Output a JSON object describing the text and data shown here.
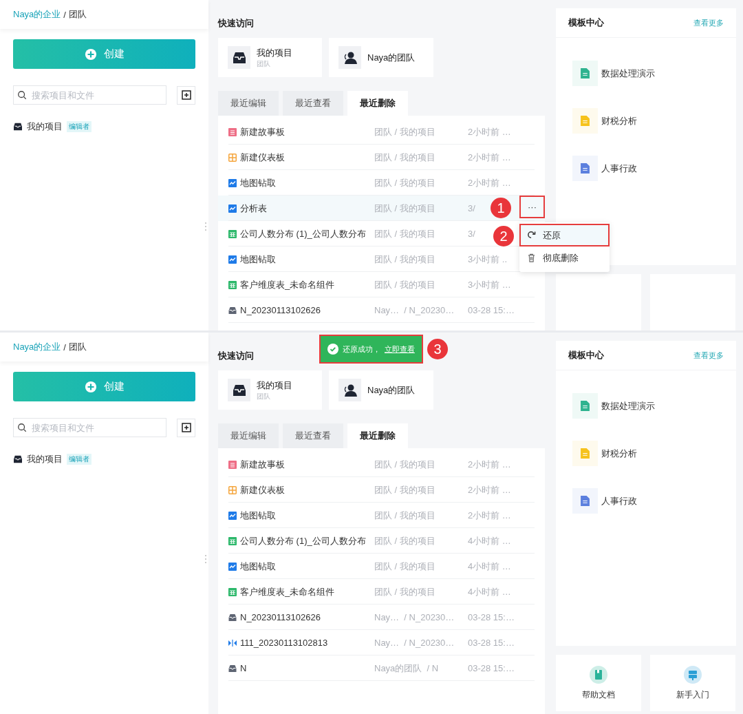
{
  "panels": [
    {
      "breadcrumb": {
        "link": "Naya的企业",
        "separator": "/",
        "current": "团队"
      },
      "create_button": "创建",
      "search": {
        "placeholder": "搜索项目和文件"
      },
      "sidebar_items": [
        {
          "label": "我的项目",
          "badge": "编辑者"
        }
      ],
      "quick_access": {
        "title": "快速访问",
        "items": [
          {
            "kind": "project",
            "title": "我的项目",
            "subtitle": "团队"
          },
          {
            "kind": "team",
            "title": "Naya的团队"
          }
        ]
      },
      "tabs": [
        {
          "label": "最近编辑",
          "selected": false
        },
        {
          "label": "最近查看",
          "selected": false
        },
        {
          "label": "最近删除",
          "selected": true
        }
      ],
      "files": [
        {
          "kind": "story",
          "name": "新建故事板",
          "path": "团队 / 我的项目",
          "time": "2小时前 …",
          "selected": false
        },
        {
          "kind": "dashboard",
          "name": "新建仪表板",
          "path": "团队 / 我的项目",
          "time": "2小时前 …",
          "selected": false
        },
        {
          "kind": "map",
          "name": "地图钻取",
          "path": "团队 / 我的项目",
          "time": "2小时前 …",
          "selected": false
        },
        {
          "kind": "map",
          "name": "分析表",
          "path": "团队 / 我的项目",
          "time": "3/",
          "selected": true,
          "menu_open": true
        },
        {
          "kind": "table",
          "name": "公司人数分布 (1)_公司人数分布",
          "path": "团队 / 我的项目",
          "time": "3/",
          "selected": false
        },
        {
          "kind": "map",
          "name": "地图钻取",
          "path": "团队 / 我的项目",
          "time": "3小时前 ..",
          "selected": false
        },
        {
          "kind": "table",
          "name": "客户维度表_未命名组件",
          "path": "团队 / 我的项目",
          "time": "3小时前 …",
          "selected": false
        },
        {
          "kind": "project",
          "name": "N_20230113102626",
          "path": "Nay…  / N_20230…",
          "time": "03-28 15:…",
          "selected": false
        }
      ],
      "row_menu": {
        "more": "···",
        "marker": "1",
        "items": [
          {
            "kind": "restore",
            "label": "还原",
            "marker": "2",
            "outlined": true
          },
          {
            "kind": "delete",
            "label": "彻底删除",
            "outlined": false
          }
        ]
      },
      "template_center": {
        "title": "模板中心",
        "more": "查看更多",
        "items": [
          {
            "name": "数据处理演示",
            "color": "#2fb38f"
          },
          {
            "name": "财税分析",
            "color": "#f6c21c"
          },
          {
            "name": "人事行政",
            "color": "#5b7fde"
          }
        ]
      }
    },
    {
      "breadcrumb": {
        "link": "Naya的企业",
        "separator": "/",
        "current": "团队"
      },
      "create_button": "创建",
      "search": {
        "placeholder": "搜索项目和文件"
      },
      "sidebar_items": [
        {
          "label": "我的项目",
          "badge": "编辑者"
        }
      ],
      "toast": {
        "message": "还原成功，",
        "link": "立即查看",
        "marker": "3"
      },
      "quick_access": {
        "title": "快速访问",
        "items": [
          {
            "kind": "project",
            "title": "我的项目",
            "subtitle": "团队"
          },
          {
            "kind": "team",
            "title": "Naya的团队"
          }
        ]
      },
      "tabs": [
        {
          "label": "最近编辑",
          "selected": false
        },
        {
          "label": "最近查看",
          "selected": false
        },
        {
          "label": "最近删除",
          "selected": true
        }
      ],
      "files": [
        {
          "kind": "story",
          "name": "新建故事板",
          "path": "团队 / 我的项目",
          "time": "2小时前 …",
          "selected": false
        },
        {
          "kind": "dashboard",
          "name": "新建仪表板",
          "path": "团队 / 我的项目",
          "time": "2小时前 …",
          "selected": false
        },
        {
          "kind": "map",
          "name": "地图钻取",
          "path": "团队 / 我的项目",
          "time": "2小时前 …",
          "selected": false
        },
        {
          "kind": "table",
          "name": "公司人数分布 (1)_公司人数分布",
          "path": "团队 / 我的项目",
          "time": "4小时前 …",
          "selected": false
        },
        {
          "kind": "map",
          "name": "地图钻取",
          "path": "团队 / 我的项目",
          "time": "4小时前 …",
          "selected": false
        },
        {
          "kind": "table",
          "name": "客户维度表_未命名组件",
          "path": "团队 / 我的项目",
          "time": "4小时前 …",
          "selected": false
        },
        {
          "kind": "project",
          "name": "N_20230113102626",
          "path": "Nay…  / N_20230…",
          "time": "03-28 15:…",
          "selected": false
        },
        {
          "kind": "component",
          "name": "111_20230113102813",
          "path": "Nay…  / N_20230…",
          "time": "03-28 15:…",
          "selected": false
        },
        {
          "kind": "project",
          "name": "N",
          "path": "Naya的团队  / N",
          "time": "03-28 15:…",
          "selected": false
        }
      ],
      "template_center": {
        "title": "模板中心",
        "more": "查看更多",
        "items": [
          {
            "name": "数据处理演示",
            "color": "#2fb38f"
          },
          {
            "name": "财税分析",
            "color": "#f6c21c"
          },
          {
            "name": "人事行政",
            "color": "#5b7fde"
          }
        ]
      },
      "help_cards": [
        {
          "kind": "docs",
          "label": "帮助文档"
        },
        {
          "kind": "guide",
          "label": "新手入门"
        }
      ]
    }
  ]
}
